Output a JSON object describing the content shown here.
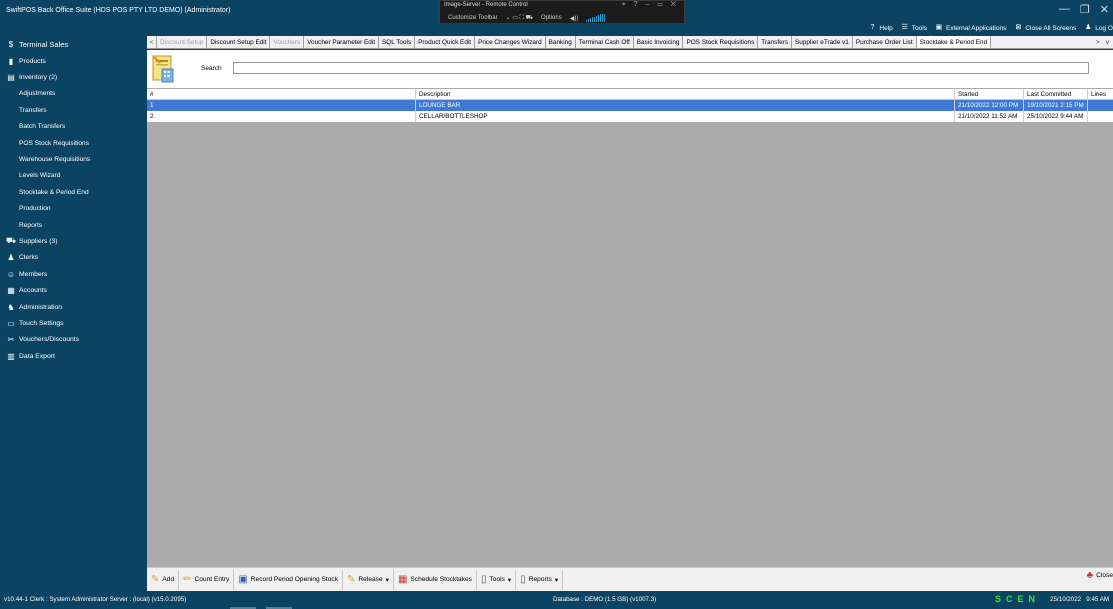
{
  "app": {
    "title": "SwiftPOS Back Office Suite (HDS POS PTY LTD DEMO) (Administrator)",
    "window_controls": [
      "—",
      "❐",
      "✕"
    ]
  },
  "remote": {
    "title": "Image-Server - Remote Control",
    "controls": "⌖ ? – ▭ ✕",
    "toolbar_label": "Customize Toolbar",
    "options_label": "Options",
    "volume_label": "◀))"
  },
  "top_tools": {
    "help": "Help",
    "tools": "Tools",
    "external": "External Applications",
    "close_all": "Close All Screens",
    "logout": "Log O"
  },
  "sidebar": {
    "items": [
      {
        "label": "Terminal Sales",
        "icon": "$"
      },
      {
        "label": "Products",
        "icon": "▮"
      },
      {
        "label": "Inventory (2)",
        "icon": "▤"
      },
      {
        "label": "Adjustments"
      },
      {
        "label": "Transfers"
      },
      {
        "label": "Batch Transfers"
      },
      {
        "label": "POS Stock Requisitions"
      },
      {
        "label": "Warehouse Requisitions"
      },
      {
        "label": "Levels Wizard"
      },
      {
        "label": "Stocktake & Period End"
      },
      {
        "label": "Production"
      },
      {
        "label": "Reports"
      },
      {
        "label": "Suppliers (3)",
        "icon": "⛟"
      },
      {
        "label": "Clerks",
        "icon": "♟"
      },
      {
        "label": "Members",
        "icon": "☺"
      },
      {
        "label": "Accounts",
        "icon": "▦"
      },
      {
        "label": "Administration",
        "icon": "♞"
      },
      {
        "label": "Touch Settings",
        "icon": "▭"
      },
      {
        "label": "Vouchers/Discounts",
        "icon": "✂"
      },
      {
        "label": "Data Export",
        "icon": "▥"
      }
    ]
  },
  "tabs": [
    {
      "label": "Discount Setup",
      "state": "disabled"
    },
    {
      "label": "Discount Setup Edit",
      "state": "normal"
    },
    {
      "label": "Vouchers",
      "state": "disabled"
    },
    {
      "label": "Voucher Parameter Edit",
      "state": "normal"
    },
    {
      "label": "SQL Tools",
      "state": "normal"
    },
    {
      "label": "Product Quick Edit",
      "state": "normal"
    },
    {
      "label": "Price Changes Wizard",
      "state": "normal"
    },
    {
      "label": "Banking",
      "state": "normal"
    },
    {
      "label": "Terminal Cash Off",
      "state": "normal"
    },
    {
      "label": "Basic Invoicing",
      "state": "normal"
    },
    {
      "label": "POS Stock Requisitions",
      "state": "normal"
    },
    {
      "label": "Transfers",
      "state": "normal"
    },
    {
      "label": "Supplier eTrade v1",
      "state": "normal"
    },
    {
      "label": "Purchase Order List",
      "state": "normal"
    },
    {
      "label": "Stocktake & Period End",
      "state": "active"
    }
  ],
  "tab_nav": {
    "left": "<",
    "right": ">",
    "menu": "v"
  },
  "search": {
    "label": "Search",
    "value": ""
  },
  "grid": {
    "headers": [
      "#",
      "Description",
      "Started",
      "Last Committed",
      "Lines"
    ],
    "rows": [
      {
        "num": "1",
        "description": "LOUNGE BAR",
        "started": "21/10/2022 12:00 PM",
        "last_committed": "19/10/2021 2:15 PM",
        "lines": "",
        "selected": true
      },
      {
        "num": "2",
        "description": "CELLAR/BOTTLESHOP",
        "started": "21/10/2022 11:52 AM",
        "last_committed": "25/10/2022 9:44 AM",
        "lines": "",
        "selected": false
      }
    ]
  },
  "toolbar": {
    "add": "Add",
    "count_entry": "Count Entry",
    "record_opening": "Record Period Opening Stock",
    "release": "Release",
    "schedule": "Schedule Stocktakes",
    "tools": "Tools",
    "reports": "Reports",
    "close": "Close",
    "dropdown": "▾"
  },
  "status": {
    "left": "v10.44-1   Clerk : System Administrator   Server : (local) (v15.0.2095)",
    "database": "Database : DEMO (1.5 GB) (v1007.3)",
    "scen": "SCEN",
    "date": "25/10/2022",
    "time": "9:45 AM"
  },
  "colors": {
    "sidebar_bg": "#0b4463",
    "selected_row": "#3e79d6",
    "grid_bg": "#ababab",
    "status_green": "#3be03b"
  }
}
